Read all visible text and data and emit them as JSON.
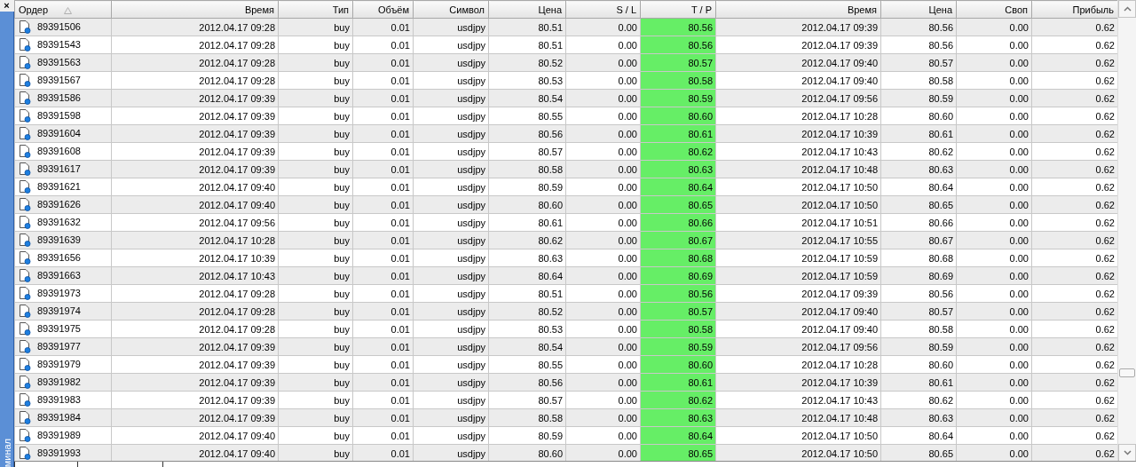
{
  "sidebar": {
    "close": "×",
    "title": "минал"
  },
  "table": {
    "columns": [
      {
        "label": "Ордер",
        "kind": "order"
      },
      {
        "label": "Время",
        "kind": "plain"
      },
      {
        "label": "Тип",
        "kind": "plain"
      },
      {
        "label": "Объём",
        "kind": "plain"
      },
      {
        "label": "Символ",
        "kind": "plain"
      },
      {
        "label": "Цена",
        "kind": "plain"
      },
      {
        "label": "S / L",
        "kind": "plain"
      },
      {
        "label": "T / P",
        "kind": "target"
      },
      {
        "label": "Время",
        "kind": "plain"
      },
      {
        "label": "Цена",
        "kind": "plain"
      },
      {
        "label": "Своп",
        "kind": "plain"
      },
      {
        "label": "Прибыль",
        "kind": "plain"
      }
    ],
    "rows": [
      [
        "89391506",
        "2012.04.17 09:28",
        "buy",
        "0.01",
        "usdjpy",
        "80.51",
        "0.00",
        "80.56",
        "2012.04.17 09:39",
        "80.56",
        "0.00",
        "0.62"
      ],
      [
        "89391543",
        "2012.04.17 09:28",
        "buy",
        "0.01",
        "usdjpy",
        "80.51",
        "0.00",
        "80.56",
        "2012.04.17 09:39",
        "80.56",
        "0.00",
        "0.62"
      ],
      [
        "89391563",
        "2012.04.17 09:28",
        "buy",
        "0.01",
        "usdjpy",
        "80.52",
        "0.00",
        "80.57",
        "2012.04.17 09:40",
        "80.57",
        "0.00",
        "0.62"
      ],
      [
        "89391567",
        "2012.04.17 09:28",
        "buy",
        "0.01",
        "usdjpy",
        "80.53",
        "0.00",
        "80.58",
        "2012.04.17 09:40",
        "80.58",
        "0.00",
        "0.62"
      ],
      [
        "89391586",
        "2012.04.17 09:39",
        "buy",
        "0.01",
        "usdjpy",
        "80.54",
        "0.00",
        "80.59",
        "2012.04.17 09:56",
        "80.59",
        "0.00",
        "0.62"
      ],
      [
        "89391598",
        "2012.04.17 09:39",
        "buy",
        "0.01",
        "usdjpy",
        "80.55",
        "0.00",
        "80.60",
        "2012.04.17 10:28",
        "80.60",
        "0.00",
        "0.62"
      ],
      [
        "89391604",
        "2012.04.17 09:39",
        "buy",
        "0.01",
        "usdjpy",
        "80.56",
        "0.00",
        "80.61",
        "2012.04.17 10:39",
        "80.61",
        "0.00",
        "0.62"
      ],
      [
        "89391608",
        "2012.04.17 09:39",
        "buy",
        "0.01",
        "usdjpy",
        "80.57",
        "0.00",
        "80.62",
        "2012.04.17 10:43",
        "80.62",
        "0.00",
        "0.62"
      ],
      [
        "89391617",
        "2012.04.17 09:39",
        "buy",
        "0.01",
        "usdjpy",
        "80.58",
        "0.00",
        "80.63",
        "2012.04.17 10:48",
        "80.63",
        "0.00",
        "0.62"
      ],
      [
        "89391621",
        "2012.04.17 09:40",
        "buy",
        "0.01",
        "usdjpy",
        "80.59",
        "0.00",
        "80.64",
        "2012.04.17 10:50",
        "80.64",
        "0.00",
        "0.62"
      ],
      [
        "89391626",
        "2012.04.17 09:40",
        "buy",
        "0.01",
        "usdjpy",
        "80.60",
        "0.00",
        "80.65",
        "2012.04.17 10:50",
        "80.65",
        "0.00",
        "0.62"
      ],
      [
        "89391632",
        "2012.04.17 09:56",
        "buy",
        "0.01",
        "usdjpy",
        "80.61",
        "0.00",
        "80.66",
        "2012.04.17 10:51",
        "80.66",
        "0.00",
        "0.62"
      ],
      [
        "89391639",
        "2012.04.17 10:28",
        "buy",
        "0.01",
        "usdjpy",
        "80.62",
        "0.00",
        "80.67",
        "2012.04.17 10:55",
        "80.67",
        "0.00",
        "0.62"
      ],
      [
        "89391656",
        "2012.04.17 10:39",
        "buy",
        "0.01",
        "usdjpy",
        "80.63",
        "0.00",
        "80.68",
        "2012.04.17 10:59",
        "80.68",
        "0.00",
        "0.62"
      ],
      [
        "89391663",
        "2012.04.17 10:43",
        "buy",
        "0.01",
        "usdjpy",
        "80.64",
        "0.00",
        "80.69",
        "2012.04.17 10:59",
        "80.69",
        "0.00",
        "0.62"
      ],
      [
        "89391973",
        "2012.04.17 09:28",
        "buy",
        "0.01",
        "usdjpy",
        "80.51",
        "0.00",
        "80.56",
        "2012.04.17 09:39",
        "80.56",
        "0.00",
        "0.62"
      ],
      [
        "89391974",
        "2012.04.17 09:28",
        "buy",
        "0.01",
        "usdjpy",
        "80.52",
        "0.00",
        "80.57",
        "2012.04.17 09:40",
        "80.57",
        "0.00",
        "0.62"
      ],
      [
        "89391975",
        "2012.04.17 09:28",
        "buy",
        "0.01",
        "usdjpy",
        "80.53",
        "0.00",
        "80.58",
        "2012.04.17 09:40",
        "80.58",
        "0.00",
        "0.62"
      ],
      [
        "89391977",
        "2012.04.17 09:39",
        "buy",
        "0.01",
        "usdjpy",
        "80.54",
        "0.00",
        "80.59",
        "2012.04.17 09:56",
        "80.59",
        "0.00",
        "0.62"
      ],
      [
        "89391979",
        "2012.04.17 09:39",
        "buy",
        "0.01",
        "usdjpy",
        "80.55",
        "0.00",
        "80.60",
        "2012.04.17 10:28",
        "80.60",
        "0.00",
        "0.62"
      ],
      [
        "89391982",
        "2012.04.17 09:39",
        "buy",
        "0.01",
        "usdjpy",
        "80.56",
        "0.00",
        "80.61",
        "2012.04.17 10:39",
        "80.61",
        "0.00",
        "0.62"
      ],
      [
        "89391983",
        "2012.04.17 09:39",
        "buy",
        "0.01",
        "usdjpy",
        "80.57",
        "0.00",
        "80.62",
        "2012.04.17 10:43",
        "80.62",
        "0.00",
        "0.62"
      ],
      [
        "89391984",
        "2012.04.17 09:39",
        "buy",
        "0.01",
        "usdjpy",
        "80.58",
        "0.00",
        "80.63",
        "2012.04.17 10:48",
        "80.63",
        "0.00",
        "0.62"
      ],
      [
        "89391989",
        "2012.04.17 09:40",
        "buy",
        "0.01",
        "usdjpy",
        "80.59",
        "0.00",
        "80.64",
        "2012.04.17 10:50",
        "80.64",
        "0.00",
        "0.62"
      ],
      [
        "89391993",
        "2012.04.17 09:40",
        "buy",
        "0.01",
        "usdjpy",
        "80.60",
        "0.00",
        "80.65",
        "2012.04.17 10:50",
        "80.65",
        "0.00",
        "0.62"
      ]
    ]
  }
}
